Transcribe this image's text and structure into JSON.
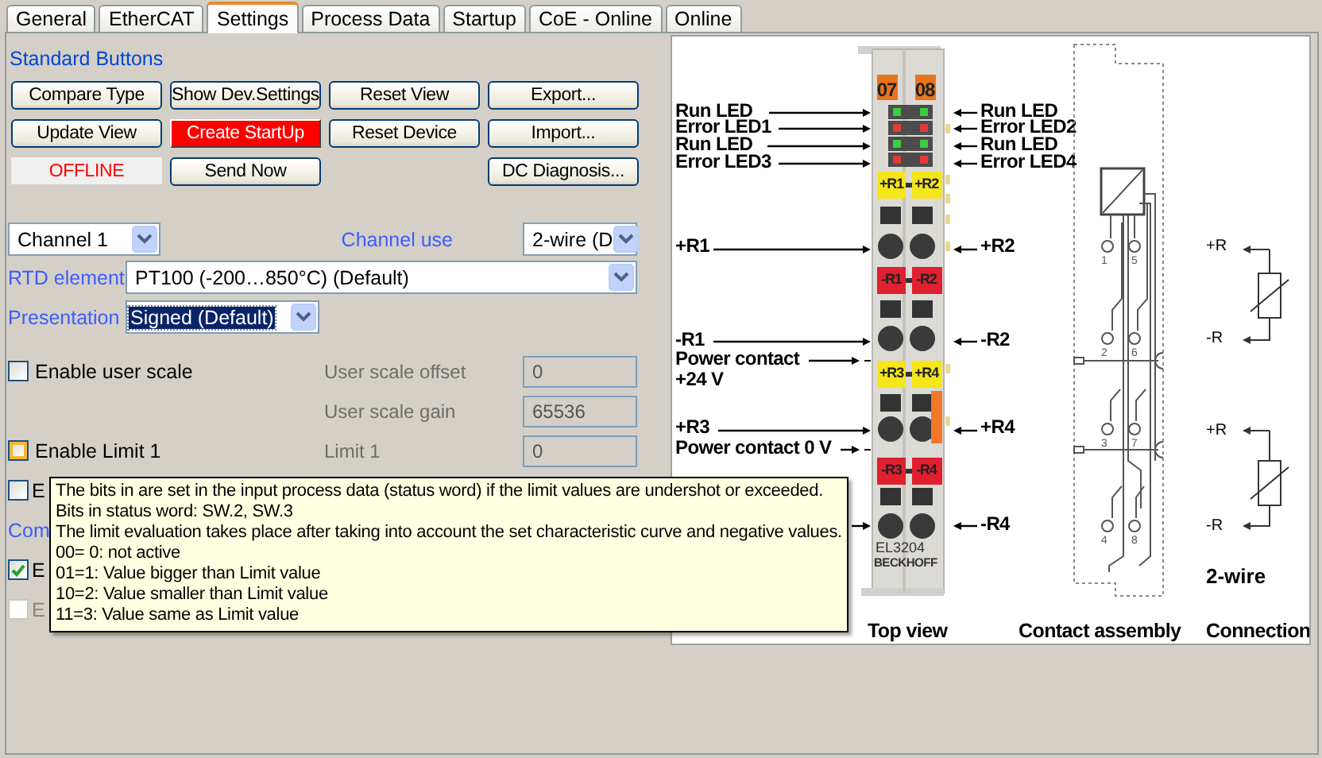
{
  "tabs": [
    {
      "label": "General",
      "selected": false
    },
    {
      "label": "EtherCAT",
      "selected": false
    },
    {
      "label": "Settings",
      "selected": true
    },
    {
      "label": "Process Data",
      "selected": false
    },
    {
      "label": "Startup",
      "selected": false
    },
    {
      "label": "CoE - Online",
      "selected": false
    },
    {
      "label": "Online",
      "selected": false
    }
  ],
  "standard_buttons": {
    "title": "Standard Buttons",
    "items": [
      {
        "kind": "button",
        "label": "Compare Type"
      },
      {
        "kind": "button",
        "label": "Show Dev.Settings"
      },
      {
        "kind": "button",
        "label": "Reset View"
      },
      {
        "kind": "button",
        "label": "Export..."
      },
      {
        "kind": "button",
        "label": "Update View"
      },
      {
        "kind": "alert",
        "label": "Create StartUp"
      },
      {
        "kind": "button",
        "label": "Reset Device"
      },
      {
        "kind": "button",
        "label": "Import..."
      },
      {
        "kind": "status",
        "label": "OFFLINE"
      },
      {
        "kind": "button",
        "label": "Send Now"
      },
      {
        "kind": "gap"
      },
      {
        "kind": "button",
        "label": "DC Diagnosis..."
      }
    ]
  },
  "channel_select": {
    "value": "Channel 1"
  },
  "channel_use": {
    "label": "Channel use",
    "value": "2-wire (D"
  },
  "rtd_element": {
    "label": "RTD element",
    "value": "PT100 (-200…850°C) (Default)"
  },
  "presentation": {
    "label": "Presentation",
    "value": "Signed (Default)",
    "selected": true
  },
  "settings_rows": [
    {
      "kind": "checkbox",
      "label": "Enable user scale",
      "checked": false,
      "hover": false,
      "disabled": false,
      "field": {
        "label": "User scale offset",
        "value": "0",
        "disabled": true
      }
    },
    {
      "kind": "field",
      "field": {
        "label": "User scale gain",
        "value": "65536",
        "disabled": true
      }
    },
    {
      "kind": "checkbox",
      "label": "Enable Limit 1",
      "checked": false,
      "hover": true,
      "disabled": false,
      "field": {
        "label": "Limit 1",
        "value": "0",
        "disabled": true
      }
    },
    {
      "kind": "checkbox",
      "label": "E",
      "checked": false,
      "hover": false,
      "disabled": false
    },
    {
      "kind": "heading",
      "label": "Com"
    },
    {
      "kind": "checkbox",
      "label": "E",
      "checked": true,
      "hover": false,
      "disabled": false
    },
    {
      "kind": "checkbox",
      "label": "E",
      "checked": false,
      "hover": false,
      "disabled": true
    }
  ],
  "tooltip": {
    "lines": [
      "The bits in are set in the input process data (status word) if the limit values are undershot or exceeded.",
      "Bits in status word: SW.2, SW.3",
      "The limit evaluation takes place after taking into account the set characteristic curve and negative values.",
      "00= 0: not active",
      "01=1: Value bigger than Limit value",
      "10=2: Value smaller than Limit value",
      "11=3: Value same as Limit value"
    ]
  },
  "diagram": {
    "left_labels": [
      "Run LED",
      "Error LED1",
      "Run LED",
      "Error LED3",
      "+R1",
      "-R1",
      "Power contact",
      "+24 V",
      "+R3",
      "Power contact 0 V"
    ],
    "right_labels": [
      "Run LED",
      "Error LED2",
      "Run LED",
      "Error LED4",
      "+R2",
      "-R2",
      "+R4",
      "-R4"
    ],
    "markings": [
      "07",
      "08",
      "+R1",
      "+R2",
      "-R1",
      "-R2",
      "+R3",
      "+R4",
      "-R3",
      "-R4"
    ],
    "model": "EL3204",
    "brand": "BECKHOFF",
    "pin_numbers": [
      "1",
      "5",
      "2",
      "6",
      "3",
      "7",
      "4",
      "8"
    ],
    "connection_labels": [
      "+R",
      "-R",
      "+R",
      "-R"
    ],
    "wiring": "2-wire",
    "captions": [
      "Top view",
      "Contact assembly",
      "Connection"
    ]
  }
}
